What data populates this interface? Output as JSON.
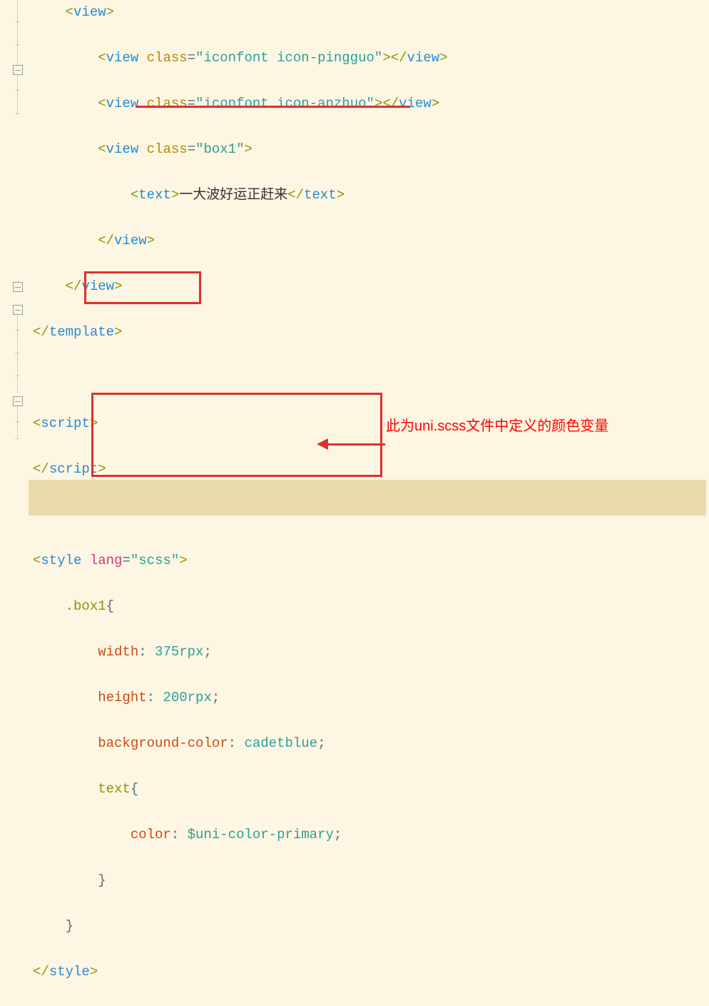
{
  "code": {
    "l1": "        <view class=\"iconfont icon-pingguo\"></view>",
    "l1_parts": {
      "indent": "        ",
      "attr": "class",
      "val": "iconfont icon-pingguo"
    },
    "l2": "        <view class=\"iconfont icon-anzhuo\"></view>",
    "l2_parts": {
      "indent": "        ",
      "attr": "class",
      "val": "iconfont icon-anzhuo"
    },
    "l3": "        <view class=\"box1\">",
    "l3_parts": {
      "indent": "        ",
      "attr": "class",
      "val": "box1"
    },
    "l4": "            <text>一大波好运正赶来</text>",
    "l4_parts": {
      "indent": "            ",
      "content": "一大波好运正赶来"
    },
    "l5": "        </view>",
    "l6": "    </view>",
    "l7": "</template>",
    "blank": "",
    "l9": "<script>",
    "l10": "</script>",
    "l12_parts": {
      "attr": "lang",
      "val": "scss"
    },
    "l13": "    .box1{",
    "l13_sel": ".box1",
    "l14_prop": "width",
    "l14_val": "375rpx",
    "l15_prop": "height",
    "l15_val": "200rpx",
    "l16_prop": "background-color",
    "l16_val": "cadetblue",
    "l17_sel": "text",
    "l18_prop": "color",
    "l18_val": "$uni-color-primary",
    "l19": "        }",
    "l20": "    }",
    "l21": "</style>"
  },
  "annotation": {
    "label": "此为uni.scss文件中定义的颜色变量"
  }
}
